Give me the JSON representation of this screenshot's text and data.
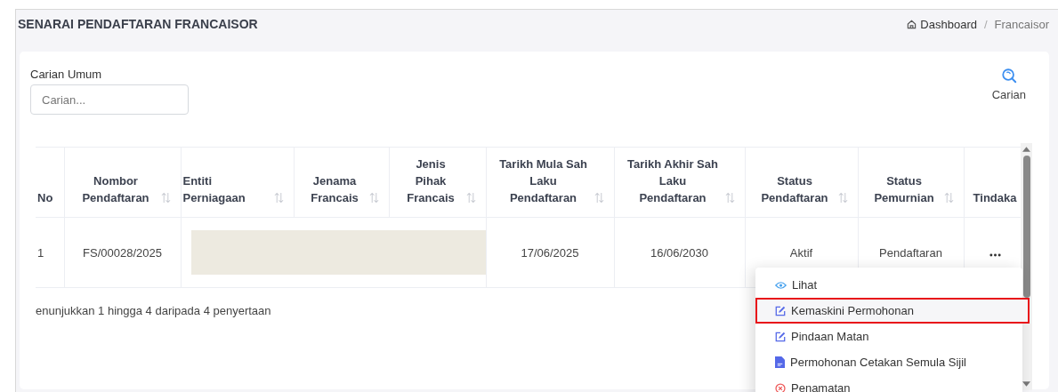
{
  "header": {
    "title": "SENARAI PENDAFTARAN FRANCAISOR",
    "breadcrumb": [
      {
        "label": "Dashboard",
        "kind": "home"
      },
      {
        "label": "Francaisor",
        "kind": "current"
      }
    ],
    "separator": "/"
  },
  "search": {
    "label": "Carian Umum",
    "placeholder": "Carian...",
    "button": "Carian"
  },
  "table": {
    "columns": [
      {
        "label": "No",
        "sortable": false
      },
      {
        "label": "Nombor Pendaftaran",
        "sortable": true
      },
      {
        "label": "Entiti Perniagaan",
        "sortable": true
      },
      {
        "label": "Jenama Francais",
        "sortable": true
      },
      {
        "label": "Jenis Pihak Francais",
        "sortable": true
      },
      {
        "label": "Tarikh Mula Sah Laku Pendaftaran",
        "sortable": true
      },
      {
        "label": "Tarikh Akhir Sah Laku Pendaftaran",
        "sortable": true
      },
      {
        "label": "Status Pendaftaran",
        "sortable": true
      },
      {
        "label": "Status Pemurnian",
        "sortable": true
      },
      {
        "label": "Tindaka",
        "sortable": false
      }
    ],
    "rows": [
      {
        "cells": [
          {
            "kind": "text",
            "text": "1"
          },
          {
            "kind": "text",
            "text": "FS/00028/2025"
          },
          {
            "kind": "redacted"
          },
          {
            "kind": "redacted"
          },
          {
            "kind": "redacted"
          },
          {
            "kind": "text",
            "text": "17/06/2025"
          },
          {
            "kind": "text",
            "text": "16/06/2030"
          },
          {
            "kind": "text",
            "text": "Aktif"
          },
          {
            "kind": "text",
            "text": "Pendaftaran"
          },
          {
            "kind": "actions"
          }
        ]
      }
    ]
  },
  "footer": "enunjukkan 1 hingga 4 daripada 4 penyertaan",
  "action_menu": {
    "items": [
      {
        "label": "Lihat",
        "kind": "view",
        "highlighted": false
      },
      {
        "label": "Kemaskini Permohonan",
        "kind": "edit",
        "highlighted": true
      },
      {
        "label": "Pindaan Matan",
        "kind": "edit",
        "highlighted": false
      },
      {
        "label": "Permohonan Cetakan Semula Sijil",
        "kind": "document",
        "highlighted": false
      },
      {
        "label": "Penamatan",
        "kind": "cancel",
        "highlighted": false
      }
    ]
  }
}
